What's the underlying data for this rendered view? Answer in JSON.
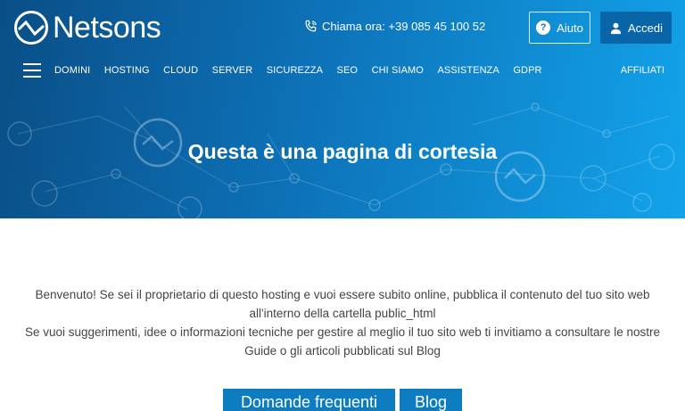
{
  "header": {
    "logo_text": "Netsons",
    "call_text": "Chiama ora: +39 085 45 100 52",
    "help_label": "Aiuto",
    "login_label": "Accedi"
  },
  "nav": {
    "items": [
      "DOMINI",
      "HOSTING",
      "CLOUD",
      "SERVER",
      "SICUREZZA",
      "SEO",
      "CHI SIAMO",
      "ASSISTENZA",
      "GDPR"
    ],
    "affiliati": "AFFILIATI"
  },
  "hero": {
    "title": "Questa è una pagina di cortesia"
  },
  "content": {
    "line1": "Benvenuto! Se sei il proprietario di questo hosting e vuoi essere subito online, pubblica il contenuto del tuo sito web",
    "line2": "all'interno della cartella public_html",
    "line3": "Se vuoi suggerimenti, idee o informazioni tecniche per gestire al meglio il tuo sito web ti invitiamo a consultare le nostre",
    "line4": "Guide o gli articoli pubblicati sul Blog"
  },
  "buttons": {
    "faq": "Domande frequenti",
    "blog": "Blog"
  },
  "colors": {
    "gradient_start": "#0a4e86",
    "gradient_end": "#12a3ea",
    "button_blue": "#0e7cc0"
  }
}
